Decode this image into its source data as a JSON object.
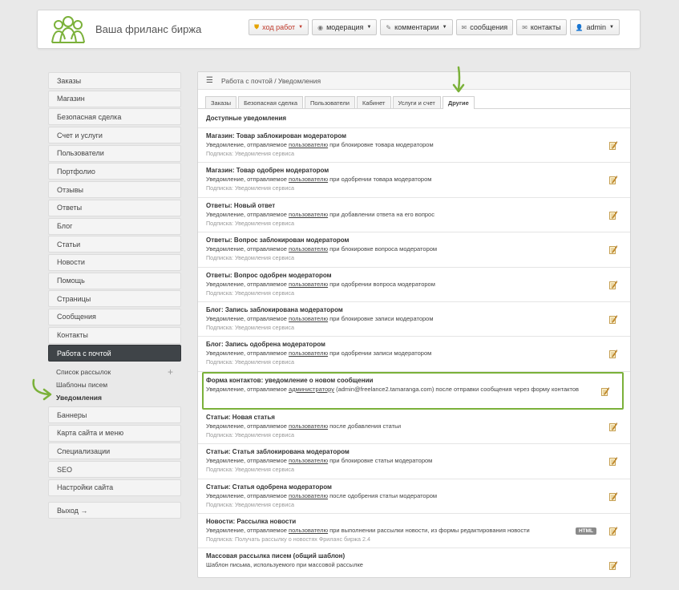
{
  "header": {
    "site_title": "Ваша фриланс биржа",
    "nav": [
      {
        "label": "ход работ",
        "icon": "shield-icon",
        "caret": true,
        "red": true
      },
      {
        "label": "модерация",
        "icon": "eye-icon",
        "caret": true
      },
      {
        "label": "комментарии",
        "icon": "pencil-icon",
        "caret": true
      },
      {
        "label": "сообщения",
        "icon": "envelope-icon",
        "caret": false
      },
      {
        "label": "контакты",
        "icon": "envelope-icon",
        "caret": false
      },
      {
        "label": "admin",
        "icon": "user-icon",
        "caret": true
      }
    ]
  },
  "sidebar": {
    "items": [
      "Заказы",
      "Магазин",
      "Безопасная сделка",
      "Счет и услуги",
      "Пользователи",
      "Портфолио",
      "Отзывы",
      "Ответы",
      "Блог",
      "Статьи",
      "Новости",
      "Помощь",
      "Страницы",
      "Сообщения",
      "Контакты"
    ],
    "active": "Работа с почтой",
    "subitems": [
      "Список рассылок",
      "Шаблоны писем",
      "Уведомления"
    ],
    "items_after": [
      "Баннеры",
      "Карта сайта и меню",
      "Специализации",
      "SEO",
      "Настройки сайта"
    ],
    "logout": "Выход →"
  },
  "main": {
    "breadcrumb": "Работа с почтой / Уведомления",
    "tabs": [
      "Заказы",
      "Безопасная сделка",
      "Пользователи",
      "Кабинет",
      "Услуги и счет",
      "Другие"
    ],
    "active_tab": "Другие",
    "section_title": "Доступные уведомления",
    "notifications": [
      {
        "title": "Магазин: Товар заблокирован модератором",
        "pre": "Уведомление, отправляемое ",
        "link": "пользователю",
        "post": " при блокировке товара модератором",
        "sub": "Подписка: Уведомления сервиса"
      },
      {
        "title": "Магазин: Товар одобрен модератором",
        "pre": "Уведомление, отправляемое ",
        "link": "пользователю",
        "post": " при одобрении товара модератором",
        "sub": "Подписка: Уведомления сервиса"
      },
      {
        "title": "Ответы: Новый ответ",
        "pre": "Уведомление, отправляемое ",
        "link": "пользователю",
        "post": " при добавлении ответа на его вопрос",
        "sub": "Подписка: Уведомления сервиса"
      },
      {
        "title": "Ответы: Вопрос заблокирован модератором",
        "pre": "Уведомление, отправляемое ",
        "link": "пользователю",
        "post": " при блокировке вопроса модератором",
        "sub": "Подписка: Уведомления сервиса"
      },
      {
        "title": "Ответы: Вопрос одобрен модератором",
        "pre": "Уведомление, отправляемое ",
        "link": "пользователю",
        "post": " при одобрении вопроса модератором",
        "sub": "Подписка: Уведомления сервиса"
      },
      {
        "title": "Блог: Запись заблокирована модератором",
        "pre": "Уведомление, отправляемое ",
        "link": "пользователю",
        "post": " при блокировке записи модератором",
        "sub": "Подписка: Уведомления сервиса"
      },
      {
        "title": "Блог: Запись одобрена модератором",
        "pre": "Уведомление, отправляемое ",
        "link": "пользователю",
        "post": " при одобрении записи модератором",
        "sub": "Подписка: Уведомления сервиса"
      },
      {
        "title": "Форма контактов: уведомление о новом сообщении",
        "pre": "Уведомление, отправляемое ",
        "link": "администратору",
        "post": " (admin@freelance2.tamaranga.com) после отправки сообщения через форму контактов",
        "sub": "",
        "highlight": true
      },
      {
        "title": "Статьи: Новая статья",
        "pre": "Уведомление, отправляемое ",
        "link": "пользователю",
        "post": " после добавления статьи",
        "sub": "Подписка: Уведомления сервиса"
      },
      {
        "title": "Статьи: Статья заблокирована модератором",
        "pre": "Уведомление, отправляемое ",
        "link": "пользователю",
        "post": " при блокировке статьи модератором",
        "sub": "Подписка: Уведомления сервиса"
      },
      {
        "title": "Статьи: Статья одобрена модератором",
        "pre": "Уведомление, отправляемое ",
        "link": "пользователю",
        "post": " после одобрения статьи модератором",
        "sub": "Подписка: Уведомления сервиса"
      },
      {
        "title": "Новости: Рассылка новости",
        "pre": "Уведомление, отправляемое ",
        "link": "пользователю",
        "post": " при выполнении рассылки новости, из формы редактирования новости",
        "sub": "Подписка: Получать рассылку о новостях Фриланс биржа 2.4",
        "badge": "HTML"
      },
      {
        "title": "Массовая рассылка писем (общий шаблон)",
        "pre": "Шаблон письма, используемого при массовой рассылке",
        "link": "",
        "post": "",
        "sub": ""
      }
    ]
  },
  "colors": {
    "highlight": "#7bb13a",
    "active_sidebar": "#3f4448"
  }
}
